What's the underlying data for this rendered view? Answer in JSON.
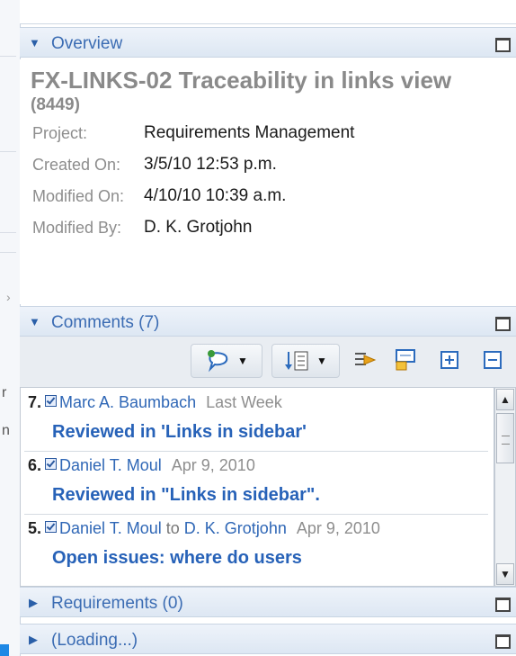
{
  "overview": {
    "header": "Overview",
    "title": "FX-LINKS-02 Traceability in links view",
    "id": "(8449)",
    "fields": [
      {
        "label": "Project:",
        "value": "Requirements Management"
      },
      {
        "label": "Created On:",
        "value": "3/5/10 12:53 p.m."
      },
      {
        "label": "Modified On:",
        "value": "4/10/10 10:39 a.m."
      },
      {
        "label": "Modified By:",
        "value": "D. K. Grotjohn"
      }
    ]
  },
  "comments": {
    "header": "Comments (7)",
    "toolbar": {
      "icons": [
        "add-comment-icon",
        "sort-icon",
        "filter-icon",
        "collapse-all-icon",
        "expand-icon",
        "minimize-icon"
      ]
    },
    "items": [
      {
        "num": "7.",
        "author": "Marc A. Baumbach",
        "to": "",
        "recipient": "",
        "date": "Last Week",
        "body": "Reviewed in 'Links in sidebar'"
      },
      {
        "num": "6.",
        "author": "Daniel T. Moul",
        "to": "",
        "recipient": "",
        "date": "Apr 9, 2010",
        "body": "Reviewed in \"Links in sidebar\"."
      },
      {
        "num": "5.",
        "author": "Daniel T. Moul",
        "to": "to",
        "recipient": "D. K. Grotjohn",
        "date": "Apr 9, 2010",
        "body": "Open issues: where do users"
      }
    ]
  },
  "requirements": {
    "header": "Requirements (0)"
  },
  "loading": {
    "header": "(Loading...)"
  },
  "left_pane": {
    "texts": [
      "r",
      "n"
    ]
  },
  "colors": {
    "accent": "#3b6cb3",
    "header_bg": "#dde7f3",
    "comment_body": "#2762b8"
  }
}
